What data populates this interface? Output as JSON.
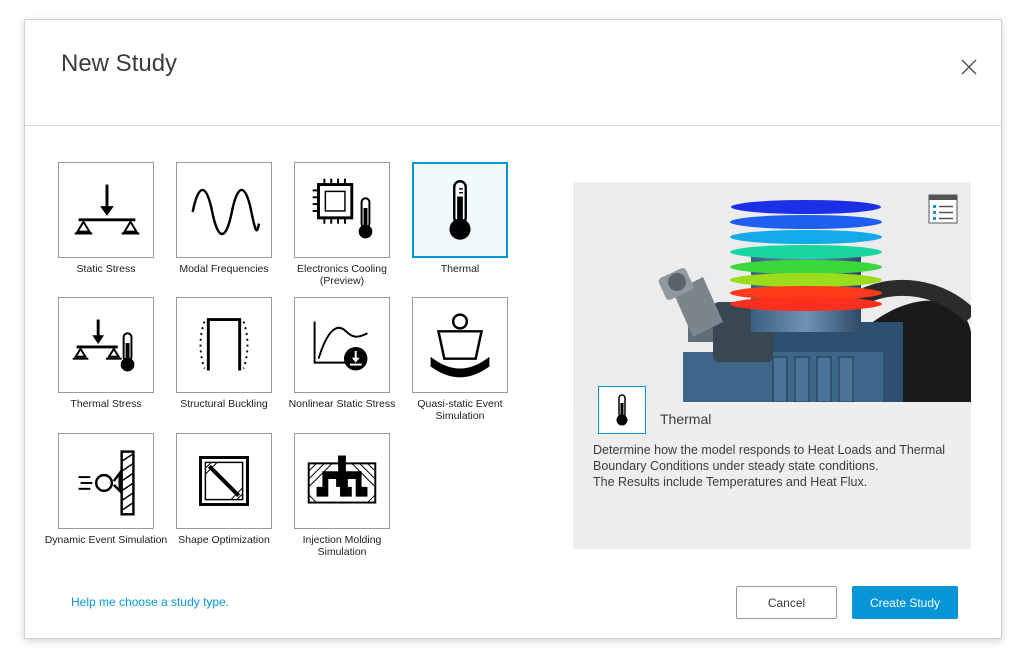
{
  "dialog": {
    "title": "New Study",
    "close_icon": "close-icon"
  },
  "study_types": [
    {
      "label": "Static Stress",
      "icon": "static-stress-icon",
      "selected": false
    },
    {
      "label": "Modal Frequencies",
      "icon": "modal-frequencies-icon",
      "selected": false
    },
    {
      "label": "Electronics Cooling (Preview)",
      "icon": "electronics-cooling-icon",
      "selected": false
    },
    {
      "label": "Thermal",
      "icon": "thermometer-icon",
      "selected": true
    },
    {
      "label": "Thermal Stress",
      "icon": "thermal-stress-icon",
      "selected": false
    },
    {
      "label": "Structural Buckling",
      "icon": "structural-buckling-icon",
      "selected": false
    },
    {
      "label": "Nonlinear Static Stress",
      "icon": "nonlinear-static-stress-icon",
      "selected": false
    },
    {
      "label": "Quasi-static Event Simulation",
      "icon": "quasi-static-event-icon",
      "selected": false
    },
    {
      "label": "Dynamic Event Simulation",
      "icon": "dynamic-event-icon",
      "selected": false
    },
    {
      "label": "Shape Optimization",
      "icon": "shape-optimization-icon",
      "selected": false
    },
    {
      "label": "Injection Molding Simulation",
      "icon": "injection-molding-icon",
      "selected": false
    }
  ],
  "preview": {
    "name": "Thermal",
    "icon": "thermometer-icon",
    "description_lines": [
      "Determine how the model responds to Heat Loads and Thermal Boundary Conditions under steady state conditions.",
      "The Results include Temperatures and Heat Flux."
    ]
  },
  "footer": {
    "help_link": "Help me choose a study type.",
    "cancel_label": "Cancel",
    "create_label": "Create Study"
  },
  "colors": {
    "accent": "#0696d7",
    "text": "#3c3c3c"
  }
}
